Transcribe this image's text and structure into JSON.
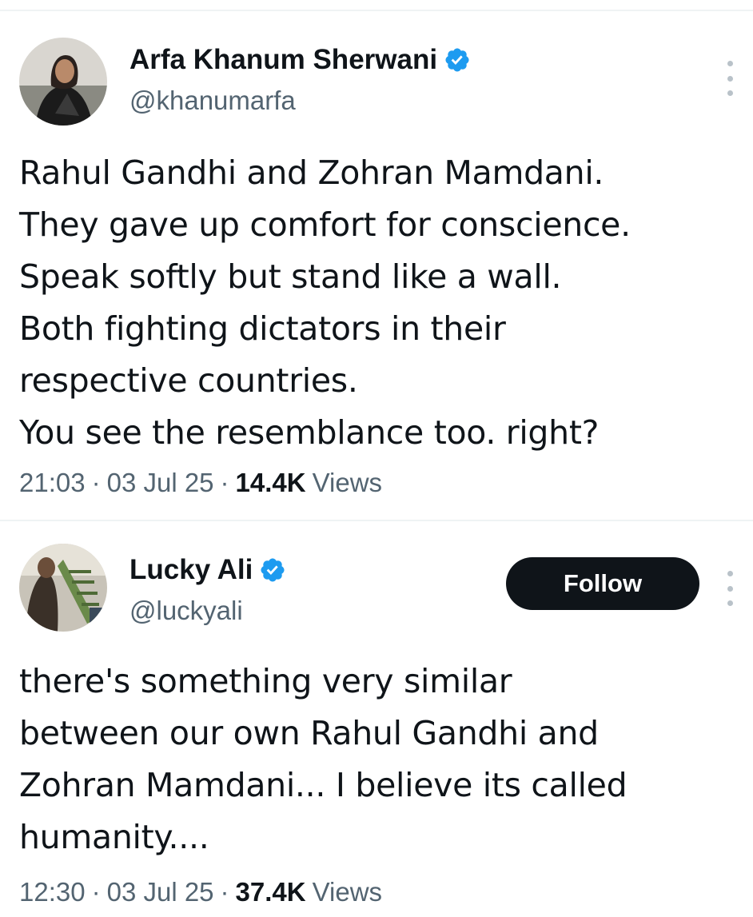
{
  "tweets": [
    {
      "author": {
        "display_name": "Arfa Khanum Sherwani",
        "handle": "@khanumarfa",
        "verified": true,
        "verified_icon": "verified-badge-icon",
        "avatar_icon": "profile-photo"
      },
      "text_lines": [
        "Rahul Gandhi and Zohran Mamdani.",
        "They gave up comfort for conscience.",
        "Speak softly but stand like a wall.",
        "Both fighting dictators in their",
        "respective countries.",
        "You see the resemblance too. right?"
      ],
      "time": "21:03",
      "date": "03 Jul 25",
      "views_count": "14.4K",
      "views_label": "Views",
      "more_icon": "more-vertical-icon"
    },
    {
      "author": {
        "display_name": "Lucky Ali",
        "handle": "@luckyali",
        "verified": true,
        "verified_icon": "verified-badge-icon",
        "avatar_icon": "profile-photo"
      },
      "follow_label": "Follow",
      "text_lines": [
        "there's something very similar",
        "between our own Rahul Gandhi and",
        "Zohran Mamdani... I believe its called",
        "humanity...."
      ],
      "time": "12:30",
      "date": "03 Jul 25",
      "views_count": "37.4K",
      "views_label": "Views",
      "more_icon": "more-vertical-icon"
    }
  ],
  "meta_separator": "·",
  "colors": {
    "verified_blue": "#1d9bf0",
    "text_primary": "#0f1419",
    "text_secondary": "#536471",
    "follow_bg": "#0f1419",
    "divider": "#eff3f4"
  }
}
